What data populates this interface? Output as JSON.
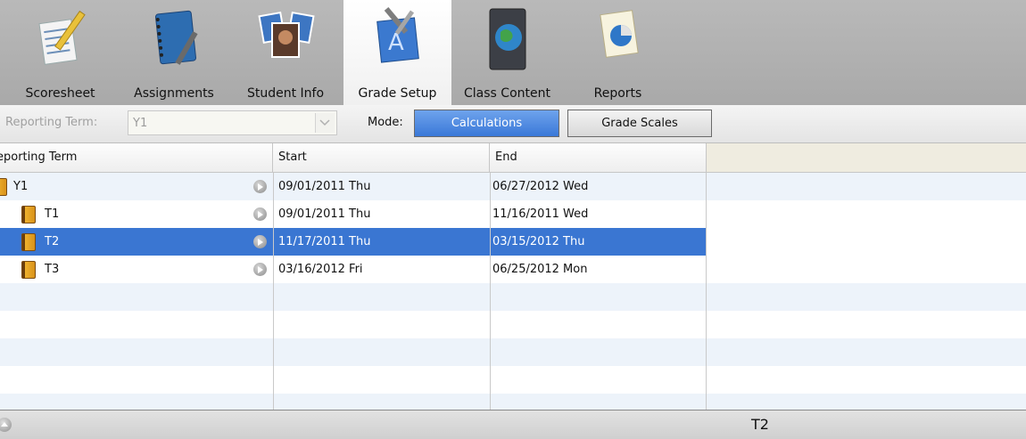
{
  "tabs": [
    {
      "label": "Scoresheet",
      "icon": "scoresheet-icon"
    },
    {
      "label": "Assignments",
      "icon": "assignments-notebook-icon"
    },
    {
      "label": "Student Info",
      "icon": "student-photos-icon"
    },
    {
      "label": "Grade Setup",
      "icon": "grade-setup-icon",
      "active": true
    },
    {
      "label": "Class Content",
      "icon": "class-content-globe-icon"
    },
    {
      "label": "Reports",
      "icon": "reports-pie-chart-icon"
    }
  ],
  "toolbar": {
    "reporting_term_label": "Reporting Term:",
    "reporting_term_value": "Y1",
    "mode_label": "Mode:",
    "calculations_label": "Calculations",
    "grade_scales_label": "Grade Scales"
  },
  "table": {
    "columns": [
      "eporting Term",
      "Start",
      "End"
    ],
    "rows": [
      {
        "term": "Y1",
        "start": "09/01/2011 Thu",
        "end": "06/27/2012 Wed"
      },
      {
        "term": "T1",
        "start": "09/01/2011 Thu",
        "end": "11/16/2011 Wed"
      },
      {
        "term": "T2",
        "start": "11/17/2011 Thu",
        "end": "03/15/2012 Thu",
        "selected": true
      },
      {
        "term": "T3",
        "start": "03/16/2012 Fri",
        "end": "06/25/2012 Mon"
      }
    ]
  },
  "status": {
    "selected_term": "T2"
  },
  "colors": {
    "selection": "#3a76d2",
    "calc_button": "#4a86e0",
    "alt_row": "#edf3fa"
  }
}
